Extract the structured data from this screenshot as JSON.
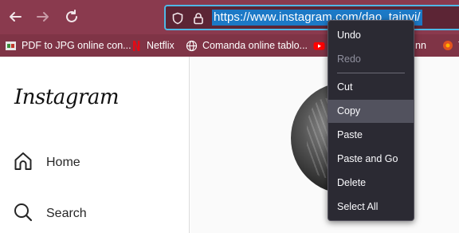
{
  "browser": {
    "url": "https://www.instagram.com/dao_tainvi/",
    "colors": {
      "toolbar": "#8a3a4e",
      "url_focus": "#4fb8e6",
      "selection": "#1c79c6"
    },
    "icons": [
      "back-icon",
      "forward-icon",
      "reload-icon",
      "shield-icon",
      "lock-icon"
    ]
  },
  "bookmarks": [
    {
      "label": "PDF to JPG online con...",
      "icon": "pdf-favicon"
    },
    {
      "label": "Netflix",
      "icon": "netflix-favicon"
    },
    {
      "label": "Comanda online tablo...",
      "icon": "globe-favicon"
    },
    {
      "label": "",
      "icon": "youtube-favicon"
    },
    {
      "label": "nn",
      "icon": ""
    },
    {
      "label": "T",
      "icon": "orange-favicon"
    }
  ],
  "instagram": {
    "logo": "Instagram",
    "nav": [
      {
        "label": "Home",
        "icon": "home-icon"
      },
      {
        "label": "Search",
        "icon": "search-icon"
      }
    ]
  },
  "context_menu": {
    "items": [
      {
        "label": "Undo",
        "enabled": true
      },
      {
        "label": "Redo",
        "enabled": false
      },
      {
        "label": "Cut",
        "enabled": true
      },
      {
        "label": "Copy",
        "enabled": true,
        "highlighted": true
      },
      {
        "label": "Paste",
        "enabled": true
      },
      {
        "label": "Paste and Go",
        "enabled": true
      },
      {
        "label": "Delete",
        "enabled": true
      },
      {
        "label": "Select All",
        "enabled": true
      }
    ]
  }
}
